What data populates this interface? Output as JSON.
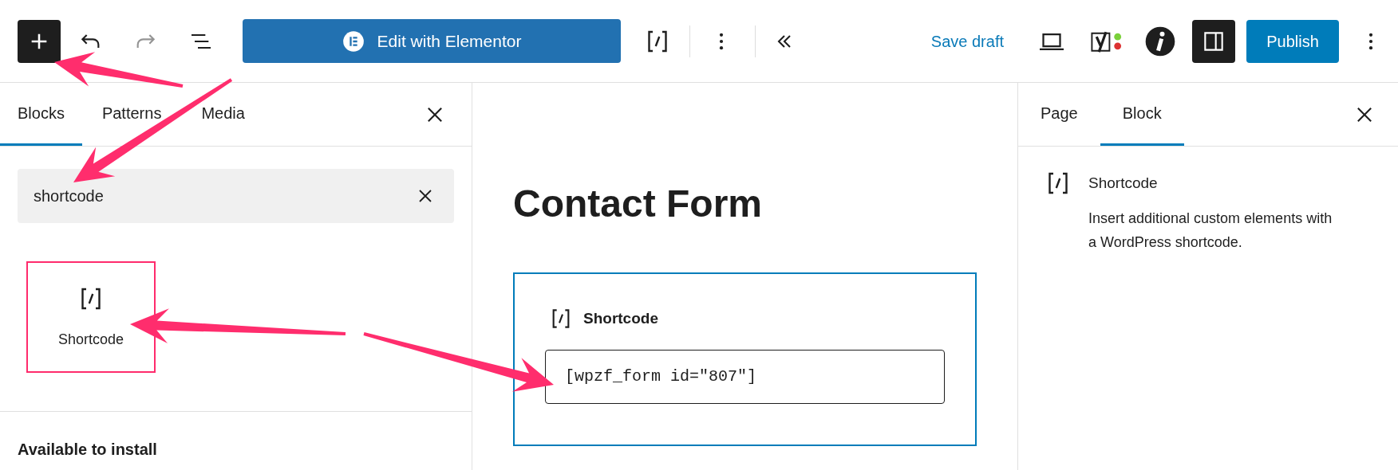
{
  "toolbar": {
    "inserter_open": true,
    "edit_button": "Edit with Elementor",
    "save_draft": "Save draft",
    "settings_open": true,
    "publish": "Publish"
  },
  "inserter": {
    "tabs": [
      {
        "label": "Blocks",
        "selected": true
      },
      {
        "label": "Patterns",
        "selected": false
      },
      {
        "label": "Media",
        "selected": false
      }
    ],
    "search": {
      "value": "shortcode"
    },
    "results": [
      {
        "label": "Shortcode",
        "highlighted": true
      }
    ],
    "section_heading": "Available to install"
  },
  "editor": {
    "title": "Contact Form",
    "block": {
      "label": "Shortcode",
      "value": "[wpzf_form id=\"807\"]",
      "selected": true
    }
  },
  "settings": {
    "tabs": [
      {
        "label": "Page",
        "selected": false
      },
      {
        "label": "Block",
        "selected": true
      }
    ],
    "block_card": {
      "title": "Shortcode",
      "description": "Insert additional custom elements with a WordPress shortcode."
    }
  }
}
